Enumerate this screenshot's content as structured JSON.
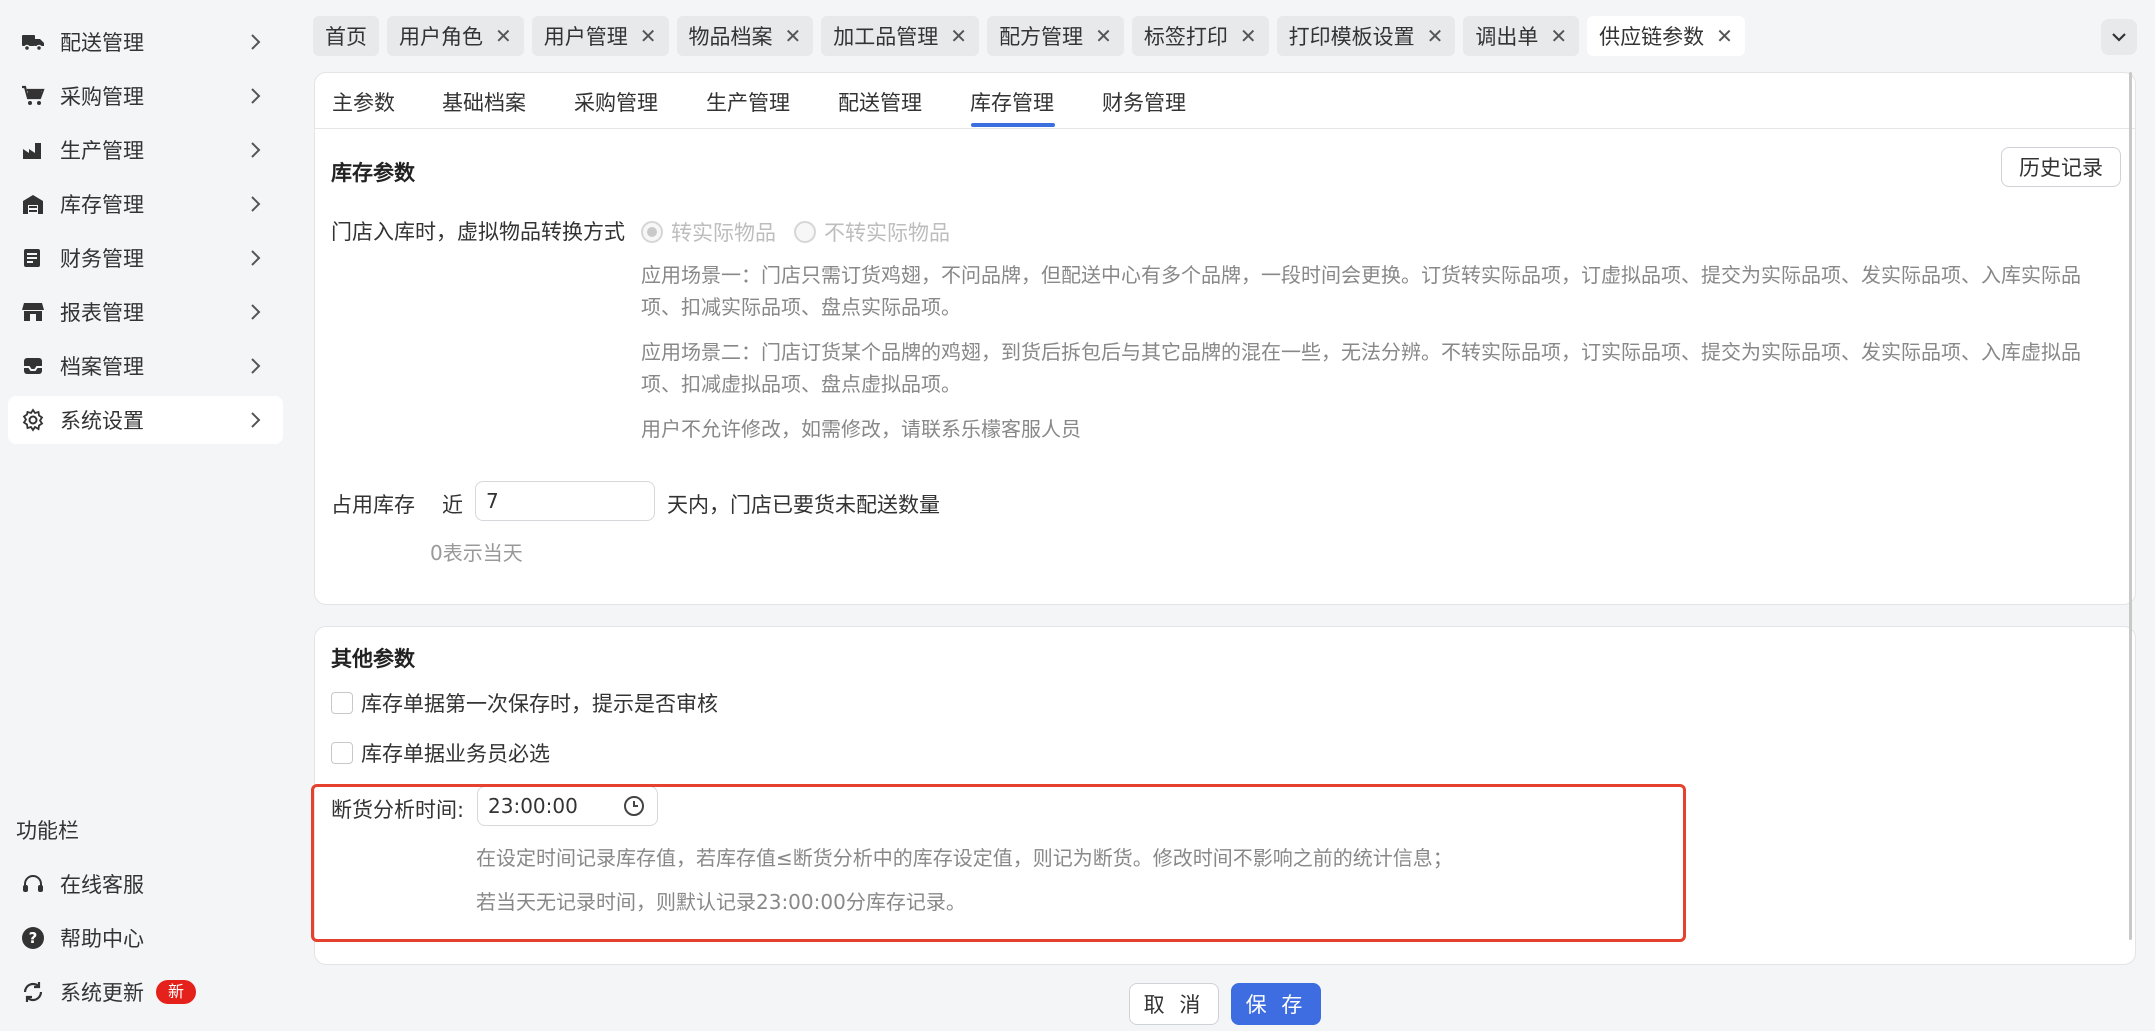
{
  "sidebar": {
    "items": [
      {
        "label": "配送管理",
        "icon": "truck-icon"
      },
      {
        "label": "采购管理",
        "icon": "cart-icon"
      },
      {
        "label": "生产管理",
        "icon": "factory-icon"
      },
      {
        "label": "库存管理",
        "icon": "warehouse-icon"
      },
      {
        "label": "财务管理",
        "icon": "ledger-icon"
      },
      {
        "label": "报表管理",
        "icon": "store-icon"
      },
      {
        "label": "档案管理",
        "icon": "inbox-icon"
      },
      {
        "label": "系统设置",
        "icon": "gear-icon"
      }
    ],
    "function_title": "功能栏",
    "functions": [
      {
        "label": "在线客服",
        "icon": "headset-icon"
      },
      {
        "label": "帮助中心",
        "icon": "help-icon"
      },
      {
        "label": "系统更新",
        "icon": "refresh-icon",
        "badge": "新"
      }
    ]
  },
  "top_tabs": [
    {
      "label": "首页",
      "closable": false
    },
    {
      "label": "用户角色",
      "closable": true
    },
    {
      "label": "用户管理",
      "closable": true
    },
    {
      "label": "物品档案",
      "closable": true
    },
    {
      "label": "加工品管理",
      "closable": true
    },
    {
      "label": "配方管理",
      "closable": true
    },
    {
      "label": "标签打印",
      "closable": true
    },
    {
      "label": "打印模板设置",
      "closable": true
    },
    {
      "label": "调出单",
      "closable": true
    },
    {
      "label": "供应链参数",
      "closable": true,
      "active": true
    }
  ],
  "sub_tabs": [
    "主参数",
    "基础档案",
    "采购管理",
    "生产管理",
    "配送管理",
    "库存管理",
    "财务管理"
  ],
  "inventory": {
    "title": "库存参数",
    "history_button": "历史记录",
    "convert_label": "门店入库时，虚拟物品转换方式",
    "radio_options": [
      "转实际物品",
      "不转实际物品"
    ],
    "desc1": "应用场景一：门店只需订货鸡翅，不问品牌，但配送中心有多个品牌，一段时间会更换。订货转实际品项，订虚拟品项、提交为实际品项、发实际品项、入库实际品项、扣减实际品项、盘点实际品项。",
    "desc2": "应用场景二：门店订货某个品牌的鸡翅，到货后拆包后与其它品牌的混在一些，无法分辨。不转实际品项，订实际品项、提交为实际品项、发实际品项、入库虚拟品项、扣减虚拟品项、盘点虚拟品项。",
    "desc3": "用户不允许修改，如需修改，请联系乐檬客服人员",
    "occupy_label": "占用库存",
    "occupy_prefix": "近",
    "occupy_value": "7",
    "occupy_suffix": "天内，门店已要货未配送数量",
    "occupy_hint": "0表示当天"
  },
  "other": {
    "title": "其他参数",
    "check1": "库存单据第一次保存时，提示是否审核",
    "check2": "库存单据业务员必选",
    "stockout_label": "断货分析时间:",
    "stockout_time": "23:00:00",
    "stockout_desc1": "在设定时间记录库存值，若库存值≤断货分析中的库存设定值，则记为断货。修改时间不影响之前的统计信息；",
    "stockout_desc2": "若当天无记录时间，则默认记录23:00:00分库存记录。"
  },
  "footer": {
    "cancel": "取 消",
    "save": "保 存"
  },
  "colors": {
    "accent": "#3d6de0",
    "highlight": "#e4412f",
    "badge": "#e5211c"
  }
}
